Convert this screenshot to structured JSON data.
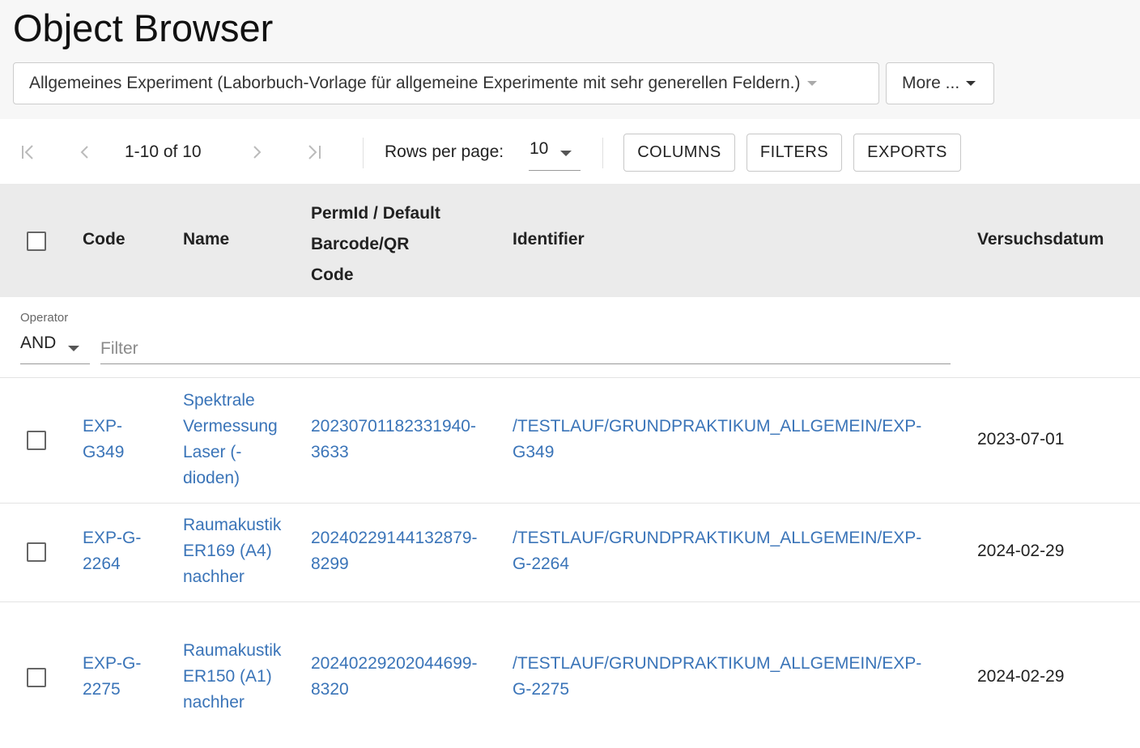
{
  "page": {
    "title": "Object Browser"
  },
  "template_select": {
    "value": "Allgemeines Experiment (Laborbuch-Vorlage für allgemeine Experimente mit sehr generellen Feldern.)"
  },
  "more": {
    "label": "More ..."
  },
  "pagination": {
    "range": "1-10 of 10",
    "rows_per_page_label": "Rows per page:",
    "rows_per_page_value": "10"
  },
  "toolbar": {
    "columns_label": "COLUMNS",
    "filters_label": "FILTERS",
    "exports_label": "EXPORTS"
  },
  "table": {
    "headers": {
      "code": "Code",
      "name": "Name",
      "permid_line1": "PermId / Default",
      "permid_line2": "Barcode/QR",
      "permid_line3": "Code",
      "identifier": "Identifier",
      "date": "Versuchsdatum"
    },
    "filter": {
      "operator_label": "Operator",
      "operator_value": "AND",
      "placeholder": "Filter",
      "value": ""
    },
    "rows": [
      {
        "code_l1": "EXP-",
        "code_l2": "G349",
        "name_l1": "Spektrale",
        "name_l2": "Vermessung",
        "name_l3": "Laser (-",
        "name_l4": "dioden)",
        "perm_l1": "20230701182331940-",
        "perm_l2": "3633",
        "ident_l1": "/TESTLAUF/GRUNDPRAKTIKUM_ALLGEMEIN/EXP-",
        "ident_l2": "G349",
        "date": "2023-07-01"
      },
      {
        "code_l1": "EXP-G-",
        "code_l2": "2264",
        "name_l1": "Raumakustik",
        "name_l2": "ER169 (A4)",
        "name_l3": "nachher",
        "perm_l1": "20240229144132879-",
        "perm_l2": "8299",
        "ident_l1": "/TESTLAUF/GRUNDPRAKTIKUM_ALLGEMEIN/EXP-",
        "ident_l2": "G-2264",
        "date": "2024-02-29"
      },
      {
        "code_l1": "EXP-G-",
        "code_l2": "2275",
        "name_l1": "Raumakustik",
        "name_l2": "ER150 (A1)",
        "name_l3": "nachher",
        "perm_l1": "20240229202044699-",
        "perm_l2": "8320",
        "ident_l1": "/TESTLAUF/GRUNDPRAKTIKUM_ALLGEMEIN/EXP-",
        "ident_l2": "G-2275",
        "date": "2024-02-29"
      }
    ]
  },
  "colors": {
    "link": "#3a74b8",
    "header_bg": "#ebebeb",
    "top_bg": "#f7f7f7"
  },
  "icons": [
    "first-page-icon",
    "prev-page-icon",
    "next-page-icon",
    "last-page-icon",
    "caret-down-icon"
  ]
}
